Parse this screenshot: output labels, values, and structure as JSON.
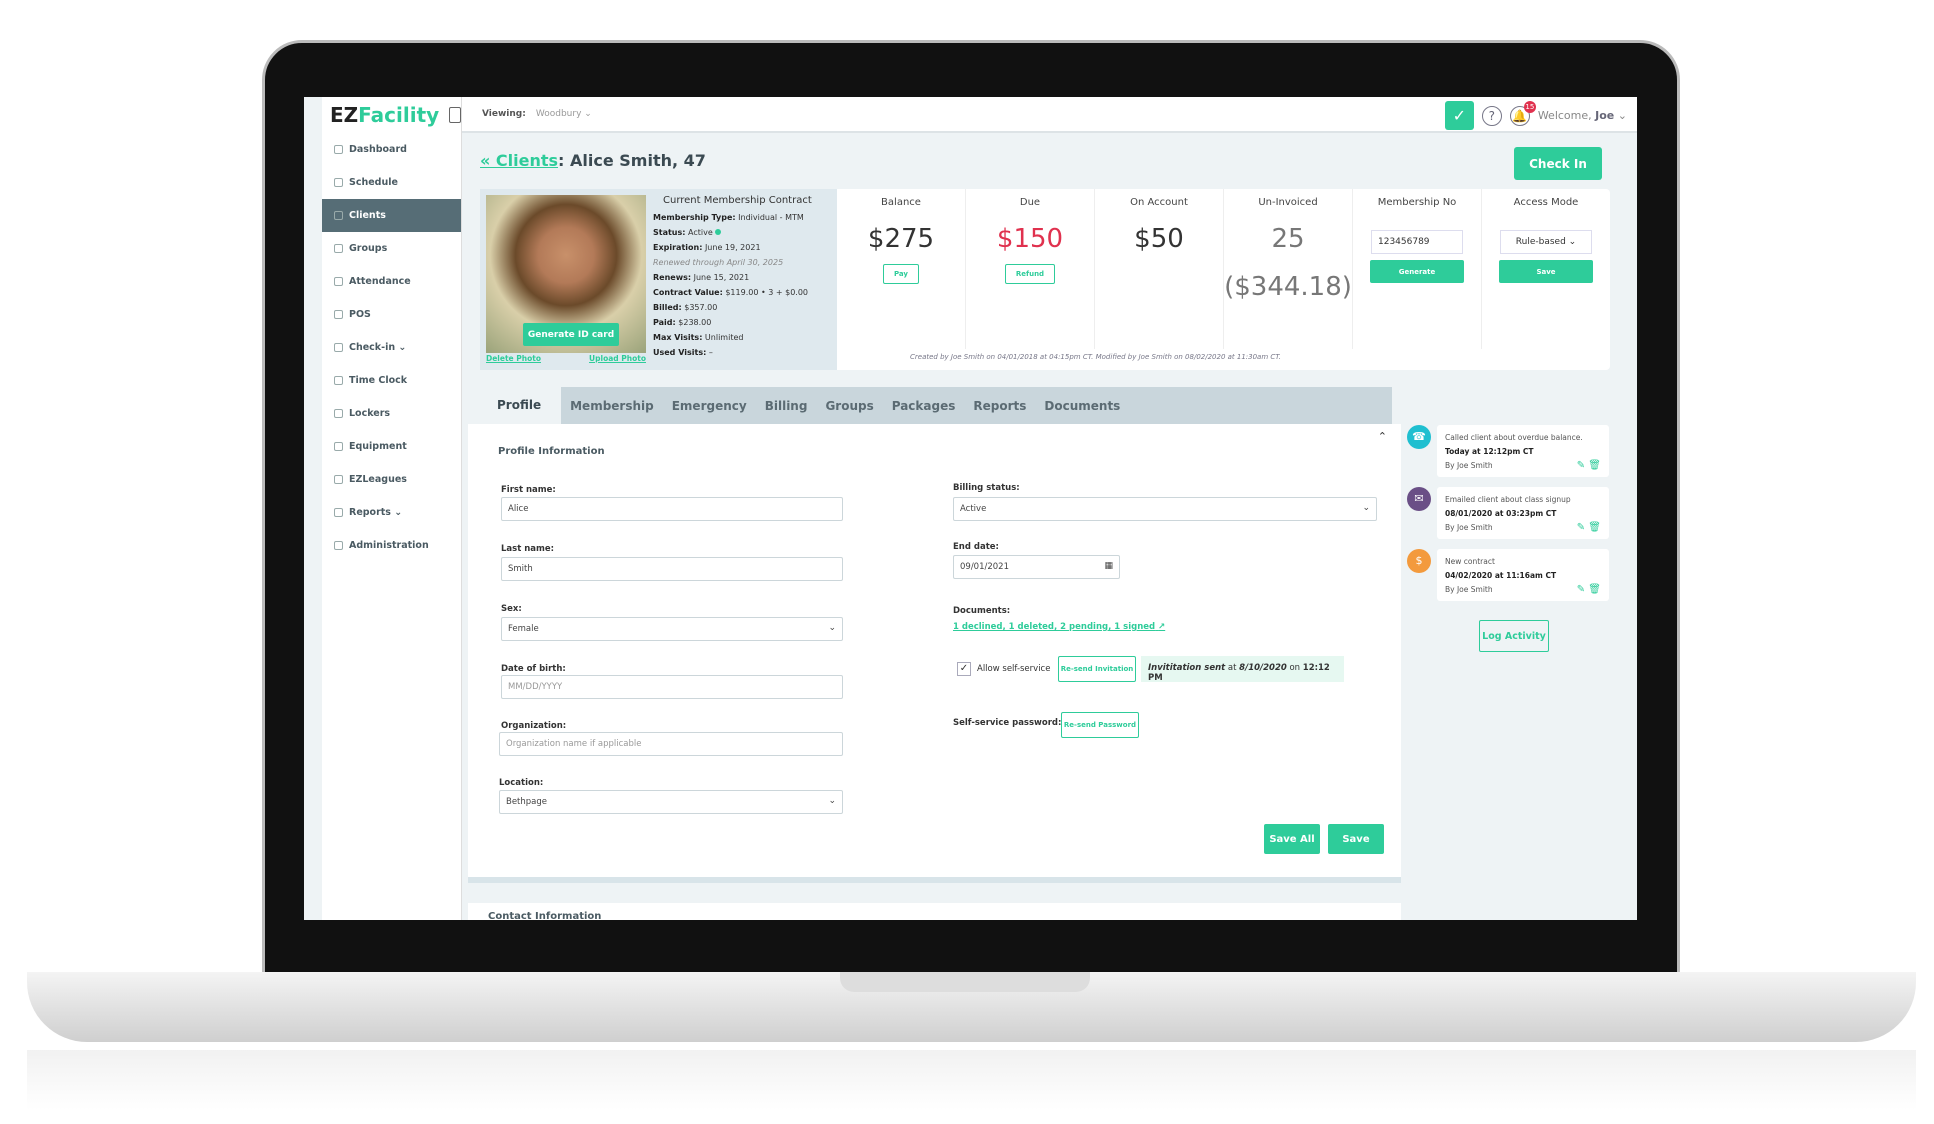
{
  "brand": {
    "ez": "EZ",
    "facility": "Facility",
    "accent": "#2ecc9a",
    "alert": "#e0314e"
  },
  "sidebar": {
    "items": [
      {
        "label": "Dashboard",
        "icon": "grid-icon"
      },
      {
        "label": "Schedule",
        "icon": "calendar-icon"
      },
      {
        "label": "Clients",
        "icon": "clients-icon",
        "active": true
      },
      {
        "label": "Groups",
        "icon": "groups-icon"
      },
      {
        "label": "Attendance",
        "icon": "check-icon"
      },
      {
        "label": "POS",
        "icon": "pos-icon"
      },
      {
        "label": "Check-in ⌄",
        "icon": "checkin-icon"
      },
      {
        "label": "Time Clock",
        "icon": "clock-icon"
      },
      {
        "label": "Lockers",
        "icon": "lock-icon"
      },
      {
        "label": "Equipment",
        "icon": "tag-icon"
      },
      {
        "label": "EZLeagues",
        "icon": "ball-icon"
      },
      {
        "label": "Reports ⌄",
        "icon": "chart-icon"
      },
      {
        "label": "Administration",
        "icon": "gear-icon"
      }
    ]
  },
  "topbar": {
    "viewing_label": "Viewing:",
    "viewing_value": "Woodbury ⌄",
    "notifications": "15",
    "welcome": "Welcome,",
    "user": "Joe"
  },
  "header": {
    "back": "« Clients",
    "client": ": Alice Smith, 47",
    "checkin": "Check In"
  },
  "contract": {
    "title": "Current Membership Contract",
    "generate_id": "Generate ID card",
    "delete_photo": "Delete Photo",
    "upload_photo": "Upload Photo",
    "rows": [
      {
        "k": "Membership Type:",
        "v": " Individual - MTM"
      },
      {
        "k": "Status:",
        "v": " Active "
      },
      {
        "k": "Expiration:",
        "v": " June 19, 2021"
      },
      {
        "k": "",
        "v": "Renewed through April 30, 2025"
      },
      {
        "k": "Renews:",
        "v": " June 15, 2021"
      },
      {
        "k": "Contract Value:",
        "v": " $119.00 • 3 + $0.00"
      },
      {
        "k": "Billed:",
        "v": " $357.00"
      },
      {
        "k": "Paid:",
        "v": " $238.00"
      },
      {
        "k": "Max Visits:",
        "v": " Unlimited"
      },
      {
        "k": "Used Visits:",
        "v": " –"
      }
    ]
  },
  "stats": {
    "balance": {
      "label": "Balance",
      "value": "$275",
      "btn": "Pay"
    },
    "due": {
      "label": "Due",
      "value": "$150",
      "btn": "Refund"
    },
    "on_account": {
      "label": "On Account",
      "value": "$50"
    },
    "uninvoiced": {
      "label": "Un-Invoiced",
      "count": "25",
      "amount": "($344.18)"
    },
    "membership_no": {
      "label": "Membership No",
      "value": "123456789",
      "btn": "Generate"
    },
    "access": {
      "label": "Access Mode",
      "value": "Rule-based",
      "btn": "Save"
    }
  },
  "created": "Created by Joe Smith on 04/01/2018 at 04:15pm CT. Modified by Joe Smith on 08/02/2020 at 11:30am CT.",
  "tabs": [
    "Profile",
    "Membership",
    "Emergency",
    "Billing",
    "Groups",
    "Packages",
    "Reports",
    "Documents"
  ],
  "profile": {
    "section": "Profile Information",
    "first_name_label": "First name:",
    "first_name": "Alice",
    "last_name_label": "Last name:",
    "last_name": "Smith",
    "sex_label": "Sex:",
    "sex": "Female",
    "dob_label": "Date of birth:",
    "dob_placeholder": "MM/DD/YYYY",
    "org_label": "Organization:",
    "org_placeholder": "Organization name if applicable",
    "location_label": "Location:",
    "location": "Bethpage",
    "billing_label": "Billing status:",
    "billing": "Active",
    "end_label": "End date:",
    "end_date": "09/01/2021",
    "documents_label": "Documents:",
    "documents": "1 declined, 1 deleted, 2 pending, 1 signed",
    "allow_self": "Allow self-service",
    "resend_invitation": "Re-send Invitation",
    "inv_sent": "Invititation sent",
    "inv_at": " at ",
    "inv_date": "8/10/2020",
    "inv_on": " on ",
    "inv_time": "12:12 PM",
    "ss_password_label": "Self-service password:",
    "resend_password": "Re-send Password",
    "save_all": "Save All",
    "save": "Save"
  },
  "contact": "Contact Information",
  "activity": [
    {
      "text": "Called client about overdue balance.",
      "when": "Today at 12:12pm CT",
      "by": "By Joe Smith",
      "icon": "phone-icon",
      "color": "#1fbfd0"
    },
    {
      "text": "Emailed client about class signup",
      "when": "08/01/2020 at 03:23pm CT",
      "by": "By Joe Smith",
      "icon": "mail-icon",
      "color": "#6a4f86"
    },
    {
      "text": "New contract",
      "when": "04/02/2020 at 11:16am CT",
      "by": "By Joe Smith",
      "icon": "contract-icon",
      "color": "#f39a3d"
    }
  ],
  "log_activity": "Log Activity"
}
